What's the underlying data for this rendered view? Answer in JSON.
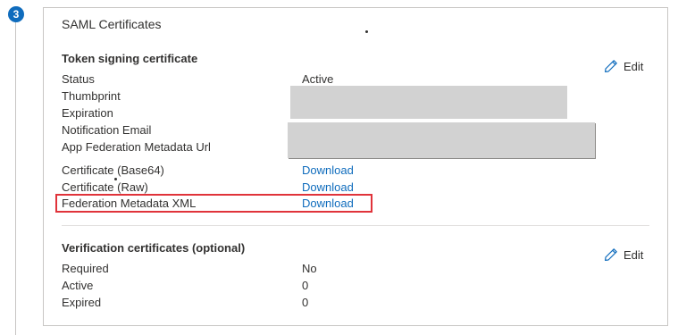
{
  "step": {
    "number": "3"
  },
  "card": {
    "title": "SAML Certificates"
  },
  "token_signing": {
    "heading": "Token signing certificate",
    "edit_label": "Edit",
    "rows": {
      "status": {
        "label": "Status",
        "value": "Active"
      },
      "thumbprint": {
        "label": "Thumbprint"
      },
      "expiration": {
        "label": "Expiration"
      },
      "notification_email": {
        "label": "Notification Email"
      },
      "metadata_url": {
        "label": "App Federation Metadata Url"
      }
    },
    "downloads": {
      "base64": {
        "label": "Certificate (Base64)",
        "link": "Download"
      },
      "raw": {
        "label": "Certificate (Raw)",
        "link": "Download"
      },
      "federation_xml": {
        "label": "Federation Metadata XML",
        "link": "Download"
      }
    }
  },
  "verification": {
    "heading": "Verification certificates (optional)",
    "edit_label": "Edit",
    "rows": {
      "required": {
        "label": "Required",
        "value": "No"
      },
      "active": {
        "label": "Active",
        "value": "0"
      },
      "expired": {
        "label": "Expired",
        "value": "0"
      }
    }
  },
  "colors": {
    "accent": "#0f6cbd",
    "highlight_border": "#e0333a",
    "redaction": "#d2d2d2"
  },
  "icons": {
    "edit": "pencil-icon"
  }
}
